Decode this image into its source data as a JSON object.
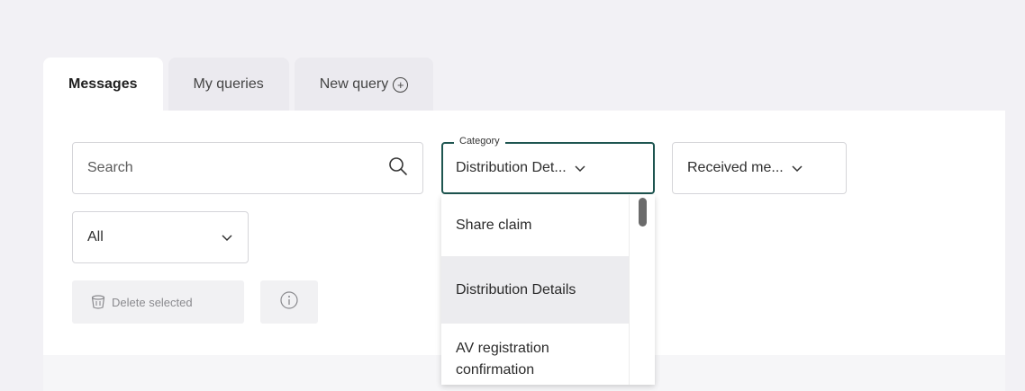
{
  "tabs": [
    {
      "label": "Messages",
      "active": true
    },
    {
      "label": "My queries",
      "active": false
    },
    {
      "label": "New query",
      "active": false
    }
  ],
  "search": {
    "placeholder": "Search",
    "value": ""
  },
  "filters": {
    "category": {
      "legend": "Category",
      "value": "Distribution Det..."
    },
    "received": {
      "value": "Received me..."
    },
    "scope": {
      "value": "All"
    }
  },
  "actions": {
    "delete_label": "Delete selected"
  },
  "dropdown": {
    "options": [
      {
        "label": "Share claim",
        "selected": false
      },
      {
        "label": "Distribution Details",
        "selected": true
      },
      {
        "label": "AV registration confirmation",
        "selected": false
      }
    ]
  },
  "colors": {
    "background": "#f2f1f5",
    "accent_border": "#1e5550",
    "selected_option": "#ececef"
  }
}
